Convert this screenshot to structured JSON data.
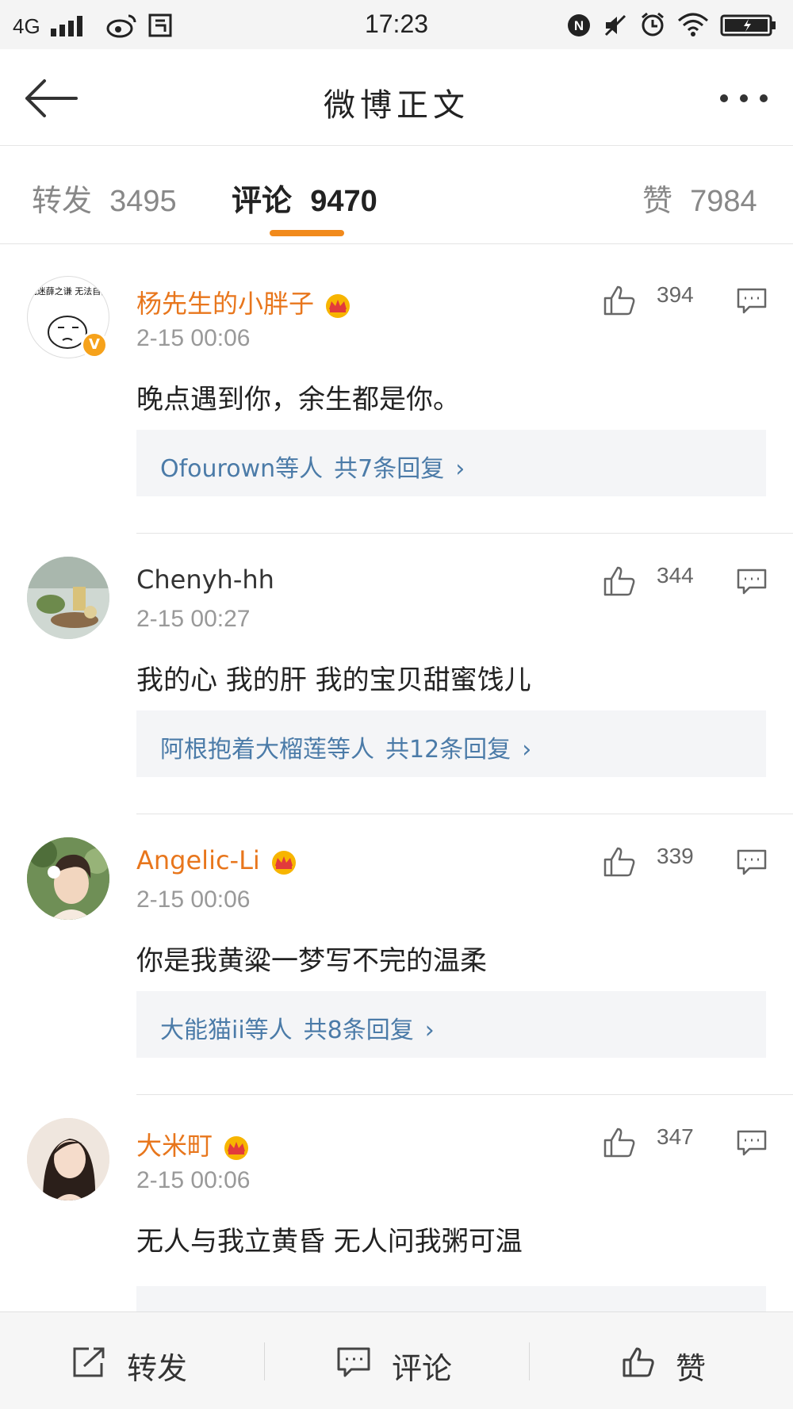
{
  "status_bar": {
    "network": "4G",
    "time": "17:23",
    "icons": [
      "signal-icon",
      "weibo-icon",
      "screenshot-icon",
      "nfc-icon",
      "mute-icon",
      "alarm-icon",
      "wifi-icon",
      "battery-icon"
    ]
  },
  "header": {
    "title": "微博正文",
    "back_icon": "back-arrow-icon",
    "more_icon": "more-icon"
  },
  "tabs": [
    {
      "label": "转发",
      "count": "3495",
      "active": false
    },
    {
      "label": "评论",
      "count": "9470",
      "active": true
    },
    {
      "label": "赞",
      "count": "7984",
      "active": false
    }
  ],
  "accent_color": "#f18a1c",
  "vip_name_color": "#e8761c",
  "link_color": "#4b7ba8",
  "comments": [
    {
      "username": "杨先生的小胖子",
      "avatar_caption": "沉迷薛之谦 无法自拔",
      "vip": true,
      "verified": true,
      "time": "2-15 00:06",
      "text": "晚点遇到你，余生都是你。",
      "likes": "394",
      "replies_users": "Ofourown等人",
      "replies_count": "共7条回复"
    },
    {
      "username": "Chenyh-hh",
      "vip": false,
      "verified": false,
      "time": "2-15 00:27",
      "text": "我的心 我的肝 我的宝贝甜蜜饯儿",
      "likes": "344",
      "replies_users": "阿根抱着大榴莲等人",
      "replies_count": "共12条回复"
    },
    {
      "username": "Angelic-Li",
      "vip": true,
      "verified": false,
      "time": "2-15 00:06",
      "text": "你是我黄粱一梦写不完的温柔",
      "likes": "339",
      "replies_users": "大能猫ii等人",
      "replies_count": "共8条回复"
    },
    {
      "username": "大米町",
      "vip": true,
      "verified": false,
      "time": "2-15 00:06",
      "text": "无人与我立黄昏 无人问我粥可温",
      "likes": "347"
    }
  ],
  "bottom_bar": [
    {
      "label": "转发",
      "icon": "repost-icon"
    },
    {
      "label": "评论",
      "icon": "comment-icon"
    },
    {
      "label": "赞",
      "icon": "like-icon"
    }
  ]
}
